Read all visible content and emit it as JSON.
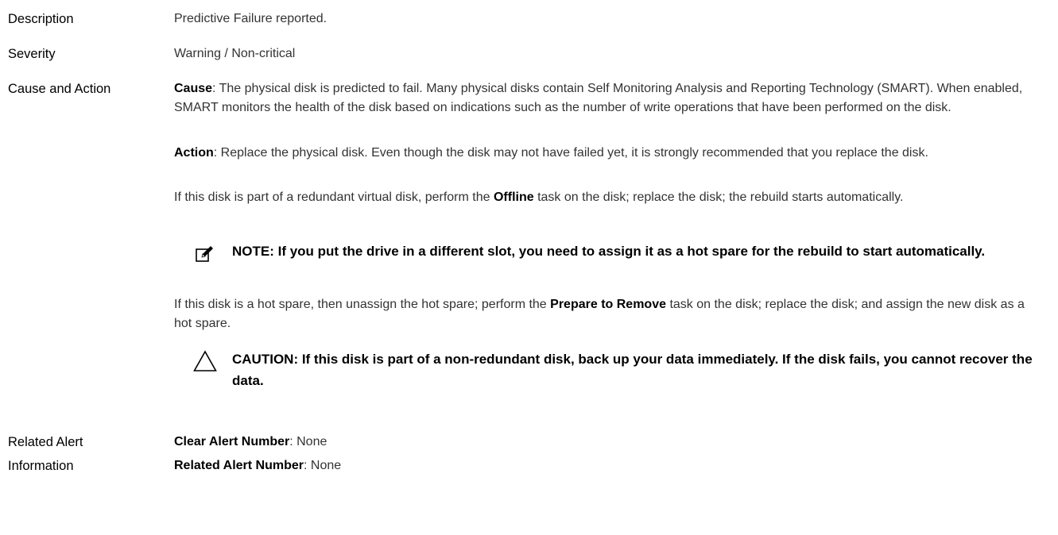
{
  "rows": {
    "description": {
      "label": "Description",
      "value": "Predictive Failure reported."
    },
    "severity": {
      "label": "Severity",
      "value": "Warning / Non-critical"
    },
    "cause_action": {
      "label": "Cause and Action",
      "cause_term": "Cause",
      "cause_text": ": The physical disk is predicted to fail. Many physical disks contain Self Monitoring Analysis and Reporting Technology (SMART). When enabled, SMART monitors the health of the disk based on indications such as the number of write operations that have been performed on the disk.",
      "action_term": "Action",
      "action_text": ": Replace the physical disk. Even though the disk may not have failed yet, it is strongly recommended that you replace the disk.",
      "redundant_pre": "If this disk is part of a redundant virtual disk, perform the ",
      "redundant_term": "Offline",
      "redundant_post": " task on the disk; replace the disk; the rebuild starts automatically.",
      "note": "NOTE: If you put the drive in a different slot, you need to assign it as a hot spare for the rebuild to start automatically.",
      "hotspare_pre": "If this disk is a hot spare, then unassign the hot spare; perform the ",
      "hotspare_term": "Prepare to Remove",
      "hotspare_post": " task on the disk; replace the disk; and assign the new disk as a hot spare.",
      "caution": "CAUTION: If this disk is part of a non-redundant disk, back up your data immediately. If the disk fails, you cannot recover the data."
    },
    "related": {
      "label_line1": "Related Alert",
      "label_line2": "Information",
      "clear_term": "Clear Alert Number",
      "clear_value": ": None",
      "related_term": "Related Alert Number",
      "related_value": ": None"
    }
  },
  "icons": {
    "note": "pencil-note-icon",
    "caution": "warning-triangle-icon"
  }
}
